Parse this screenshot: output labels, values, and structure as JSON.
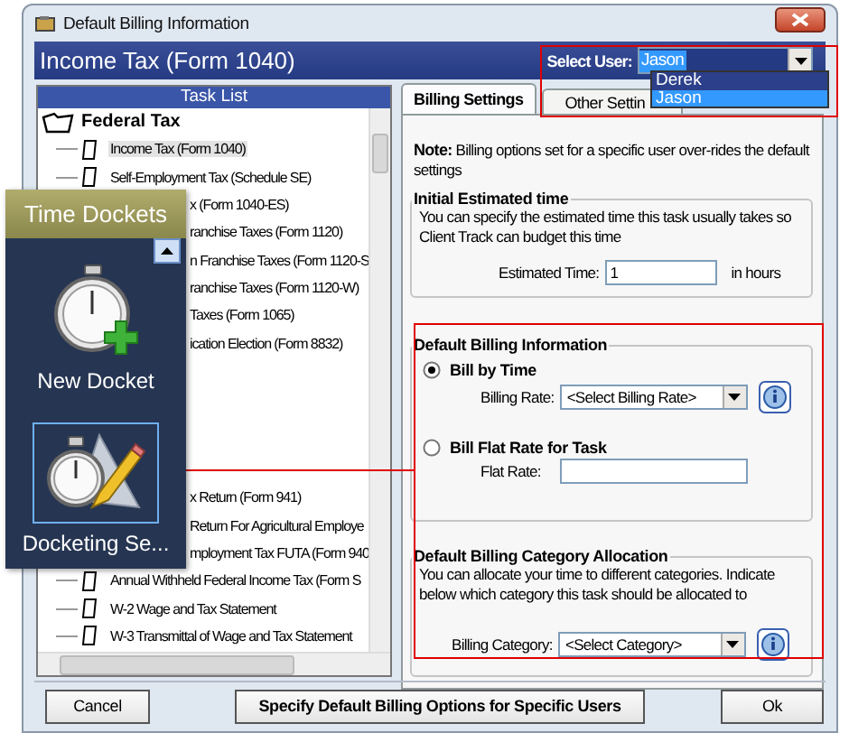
{
  "window": {
    "title": "Default Billing Information"
  },
  "header": {
    "title": "Income Tax (Form 1040)",
    "user_label": "Select User:",
    "user_value": "Jason",
    "user_options": [
      {
        "label": "Derek",
        "selected": false
      },
      {
        "label": "Jason",
        "selected": true
      }
    ]
  },
  "task_list": {
    "title": "Task List",
    "tree": [
      {
        "label": "Federal Tax",
        "expanded": true,
        "children": [
          {
            "label": "Income Tax (Form 1040)",
            "selected": true,
            "covered": false
          },
          {
            "label": "Self-Employment Tax (Schedule SE)",
            "selected": false,
            "covered": false
          },
          {
            "label": "x (Form 1040-ES)",
            "selected": false,
            "covered": true
          },
          {
            "label": "ranchise Taxes (Form 1120)",
            "selected": false,
            "covered": true
          },
          {
            "label": "n Franchise Taxes (Form 1120-S",
            "selected": false,
            "covered": true
          },
          {
            "label": "ranchise Taxes (Form 1120-W)",
            "selected": false,
            "covered": true
          },
          {
            "label": "Taxes (Form 1065)",
            "selected": false,
            "covered": true
          },
          {
            "label": "ication Election (Form 8832)",
            "selected": false,
            "covered": true
          },
          {
            "label": "x Return (Form 941)",
            "selected": false,
            "covered": true
          },
          {
            "label": "Return For Agricultural Employe",
            "selected": false,
            "covered": true
          },
          {
            "label": "mployment Tax FUTA (Form 940",
            "selected": false,
            "covered": true
          },
          {
            "label": "Annual Withheld Federal Income Tax (Form S",
            "selected": false,
            "covered": false
          },
          {
            "label": "W-2 Wage and Tax Statement",
            "selected": false,
            "covered": false
          },
          {
            "label": "W-3 Transmittal of Wage and Tax Statement",
            "selected": false,
            "covered": false
          }
        ]
      }
    ]
  },
  "tabs": [
    {
      "label": "Billing Settings",
      "selected": true
    },
    {
      "label": "Other Settin",
      "selected": false
    }
  ],
  "note": {
    "label": "Note:",
    "text": "Billing options set for a specific user over-rides the default settings"
  },
  "estimate": {
    "title": "Initial Estimated time",
    "text": "You can specify the estimated time this task usually takes so Client Track can budget this time",
    "field_label": "Estimated Time:",
    "value": "1",
    "unit": "in hours"
  },
  "billing": {
    "title": "Default Billing Information",
    "options": [
      {
        "label": "Bill by Time",
        "selected": true,
        "field_label": "Billing Rate:",
        "kind": "select",
        "value": "<Select Billing Rate>"
      },
      {
        "label": "Bill Flat Rate for Task",
        "selected": false,
        "field_label": "Flat Rate:",
        "kind": "text"
      }
    ]
  },
  "category": {
    "title": "Default Billing Category Allocation",
    "text": "You can allocate your time to different categories.  Indicate below which category this task should be allocated to",
    "field_label": "Billing Category:",
    "value": "<Select Category>"
  },
  "buttons": [
    {
      "label": "Cancel"
    },
    {
      "label": "Specify Default Billing Options for Specific Users"
    },
    {
      "label": "Ok"
    }
  ],
  "dockets": {
    "title": "Time Dockets",
    "items": [
      {
        "label": "New Docket",
        "kind": "new",
        "selected": false
      },
      {
        "label": "Docketing Se...",
        "kind": "settings",
        "selected": true
      }
    ]
  }
}
